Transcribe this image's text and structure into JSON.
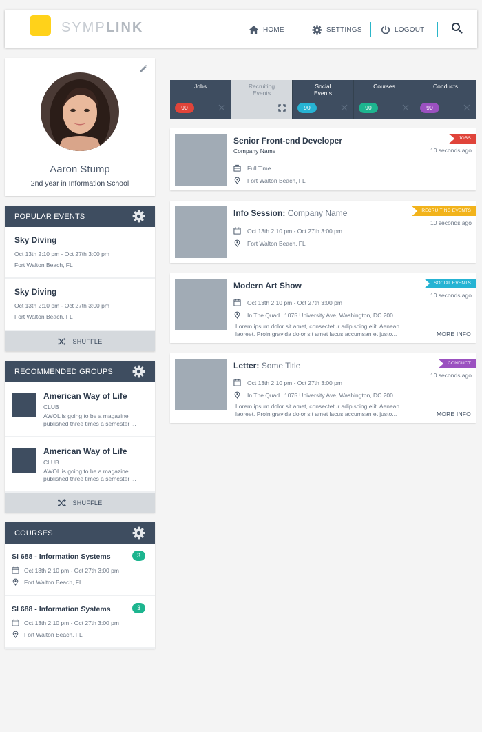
{
  "brand": {
    "logo_part1": "SYMP",
    "logo_part2": "LINK",
    "logo_color": "#ffd21a",
    "accent": "#2bb6c9"
  },
  "nav": {
    "home": "HOME",
    "settings": "SETTINGS",
    "logout": "LOGOUT"
  },
  "profile": {
    "name": "Aaron Stump",
    "subtitle": "2nd year in Information School"
  },
  "popular_events": {
    "title": "POPULAR EVENTS",
    "items": [
      {
        "title": "Sky Diving",
        "date": "Oct 13th 2:10 pm - Oct 27th  3:00 pm",
        "location": "Fort Walton Beach, FL"
      },
      {
        "title": "Sky Diving",
        "date": "Oct 13th 2:10 pm - Oct 27th  3:00 pm",
        "location": "Fort Walton Beach, FL"
      }
    ],
    "shuffle": "SHUFFLE"
  },
  "recommended_groups": {
    "title": "RECOMMENDED GROUPS",
    "items": [
      {
        "title": "American Way of Life",
        "type": "CLUB",
        "desc_line1": "AWOL is going to be a magazine",
        "desc_line2": "published three times a semester ..."
      },
      {
        "title": "American Way of Life",
        "type": "CLUB",
        "desc_line1": "AWOL is going to be a magazine",
        "desc_line2": "published three times a semester ..."
      }
    ],
    "shuffle": "SHUFFLE"
  },
  "courses": {
    "title": "COURSES",
    "items": [
      {
        "title": "SI 688 - Information Systems",
        "badge": "3",
        "date": "Oct 13th 2:10 pm - Oct 27th  3:00 pm",
        "location": "Fort Walton Beach, FL"
      },
      {
        "title": "SI 688 - Information Systems",
        "badge": "3",
        "date": "Oct 13th 2:10 pm - Oct 27th  3:00 pm",
        "location": "Fort Walton Beach, FL"
      }
    ]
  },
  "tabs": [
    {
      "line1": "Jobs",
      "line2": "",
      "count": "90",
      "color": "#e0443a"
    },
    {
      "line1": "Recruiting",
      "line2": "Events",
      "count": "",
      "color": ""
    },
    {
      "line1": "Social",
      "line2": "Events",
      "count": "90",
      "color": "#26b3d3"
    },
    {
      "line1": "Courses",
      "line2": "",
      "count": "90",
      "color": "#1db58f"
    },
    {
      "line1": "Conducts",
      "line2": "",
      "count": "90",
      "color": "#9b51c0"
    }
  ],
  "feed": [
    {
      "title_bold": "Senior Front-end Developer",
      "title_light": "",
      "company": "Company Name",
      "tag": "JOBS",
      "tag_color": "#e0443a",
      "time": "10 seconds ago",
      "meta1": "Full Time",
      "meta2": "Fort Walton Beach, FL"
    },
    {
      "title_bold": "Info Session:",
      "title_light": "Company Name",
      "tag": "RECRUITING EVENTS",
      "tag_color": "#f2b31b",
      "time": "10 seconds ago",
      "meta1": "Oct 13th 2:10 pm - Oct 27th  3:00 pm",
      "meta2": "Fort Walton Beach, FL"
    },
    {
      "title_bold": "Modern Art Show",
      "title_light": "",
      "tag": "SOCIAL EVENTS",
      "tag_color": "#26b3d3",
      "time": "10 seconds ago",
      "meta1": "Oct 13th 2:10 pm - Oct 27th  3:00 pm",
      "meta2": "In The Quad | 1075 University Ave, Washington, DC 200",
      "desc_line1": "Lorem ipsum dolor sit amet, consectetur adipiscing elit. Aenean",
      "desc_line2": "laoreet. Proin gravida dolor sit amet lacus accumsan et justo...",
      "more": "MORE INFO"
    },
    {
      "title_bold": "Letter:",
      "title_light": "Some Title",
      "tag": "CONDUCT",
      "tag_color": "#9b51c0",
      "time": "10 seconds ago",
      "meta1": "Oct 13th 2:10 pm - Oct 27th  3:00 pm",
      "meta2": "In The Quad | 1075 University Ave, Washington, DC 200",
      "desc_line1": "Lorem ipsum dolor sit amet, consectetur adipiscing elit. Aenean",
      "desc_line2": "laoreet. Proin gravida dolor sit amet lacus accumsan et justo...",
      "more": "MORE INFO"
    }
  ]
}
